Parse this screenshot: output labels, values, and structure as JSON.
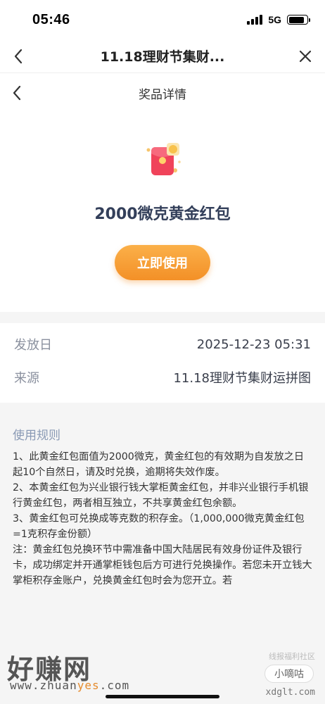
{
  "status_bar": {
    "time": "05:46",
    "network": "5G"
  },
  "browser_nav": {
    "title": "11.18理财节集财..."
  },
  "page_header": {
    "title": "奖品详情"
  },
  "prize": {
    "name": "2000微克黄金红包",
    "button_label": "立即使用"
  },
  "info": {
    "rows": [
      {
        "label": "发放日",
        "value": "2025-12-23 05:31"
      },
      {
        "label": "来源",
        "value": "11.18理财节集财运拼图"
      }
    ]
  },
  "rules": {
    "title": "使用规则",
    "paragraphs": [
      "1、此黄金红包面值为2000微克，黄金红包的有效期为自发放之日起10个自然日，请及时兑换，逾期将失效作废。",
      "2、本黄金红包为兴业银行钱大掌柜黄金红包，并非兴业银行手机银行黄金红包，两者相互独立，不共享黄金红包余额。",
      "3、黄金红包可兑换成等克数的积存金。（1,000,000微克黄金红包=1克积存金份额）",
      "注：黄金红包兑换环节中需准备中国大陆居民有效身份证件及银行卡，成功绑定并开通掌柜钱包后方可进行兑换操作。若您未开立钱大掌柜积存金账户，兑换黄金红包时会为您开立。若"
    ]
  },
  "watermarks": {
    "site_name": "好赚网",
    "site_url_prefix": "www.zhuan",
    "site_url_accent": "yes",
    "site_url_suffix": ".com",
    "right_small": "线报福利社区",
    "right_badge": "小嘀咕",
    "right_url": "xdglt.com"
  },
  "colors": {
    "button_gradient_top": "#fbb049",
    "button_gradient_bottom": "#f39027",
    "prize_name": "#333f5a",
    "rules_title": "#8a9ab5"
  }
}
